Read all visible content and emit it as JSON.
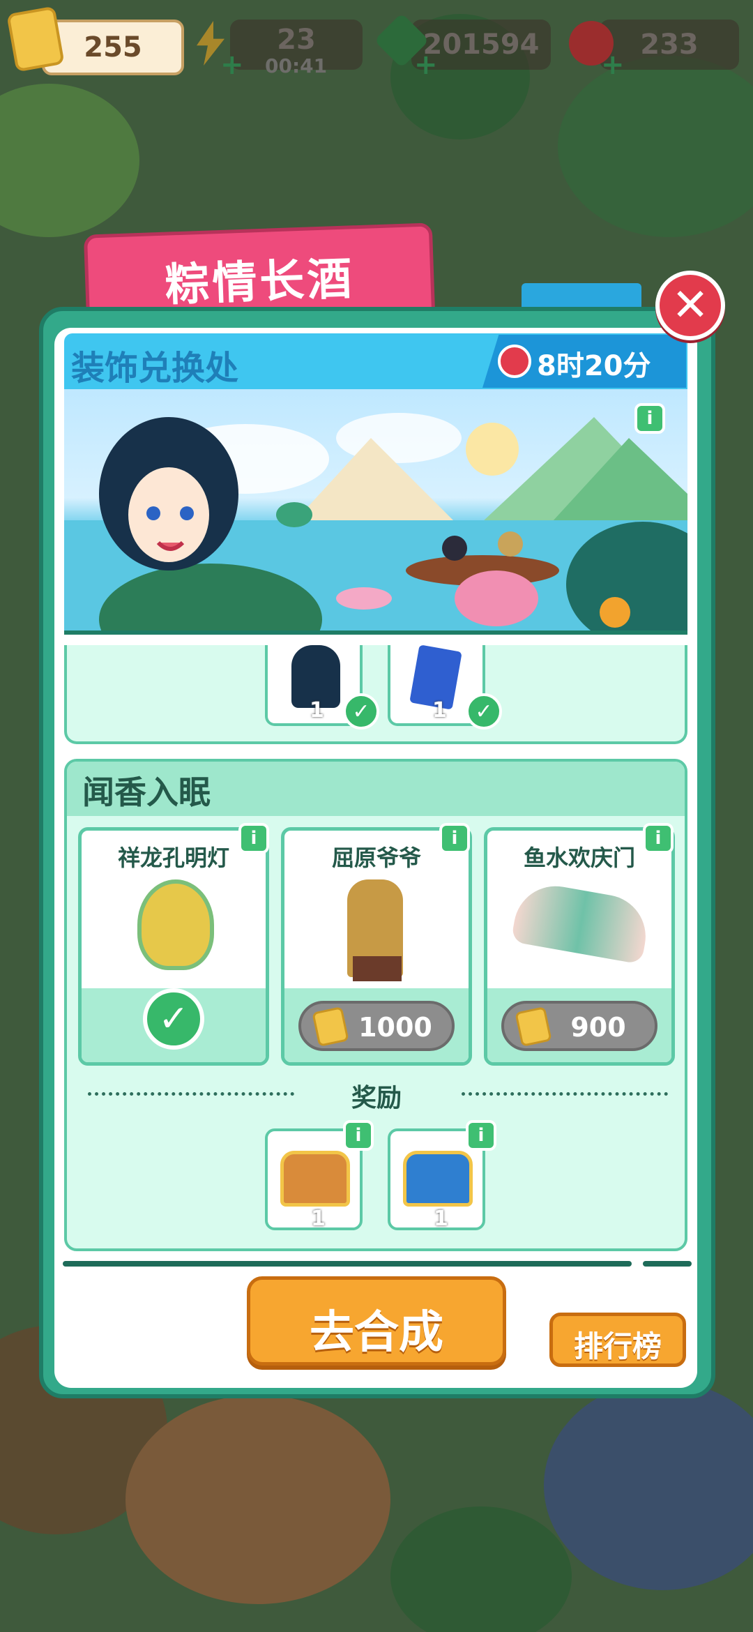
{
  "hud": {
    "tickets": "255",
    "energy": "23",
    "energy_timer": "00:41",
    "coins": "201594",
    "gems": "233"
  },
  "dialog": {
    "tab_title": "粽情长酒",
    "header_title": "装饰兑换处",
    "time_left": "8时20分",
    "info_label": "i",
    "top_rewards": [
      {
        "icon": "character-figure-icon",
        "qty": "1",
        "claimed": true
      },
      {
        "icon": "upgrade-card-icon",
        "qty": "1",
        "claimed": true
      }
    ],
    "section": {
      "title": "闻香入眠",
      "items": [
        {
          "name": "祥龙孔明灯",
          "owned": true,
          "price": ""
        },
        {
          "name": "屈原爷爷",
          "owned": false,
          "price": "1000"
        },
        {
          "name": "鱼水欢庆门",
          "owned": false,
          "price": "900"
        }
      ],
      "reward_label": "奖励",
      "rewards": [
        {
          "icon": "treasure-chest-icon",
          "qty": "1"
        },
        {
          "icon": "royal-chest-icon",
          "qty": "1"
        }
      ]
    },
    "compose_button": "去合成",
    "ranking_button": "排行榜",
    "close_icon": "close-icon"
  },
  "colors": {
    "tab": "#ee4b7c",
    "panel": "#33a98a",
    "header": "#3fc6f0",
    "button": "#f7a630",
    "check": "#37b86a"
  }
}
